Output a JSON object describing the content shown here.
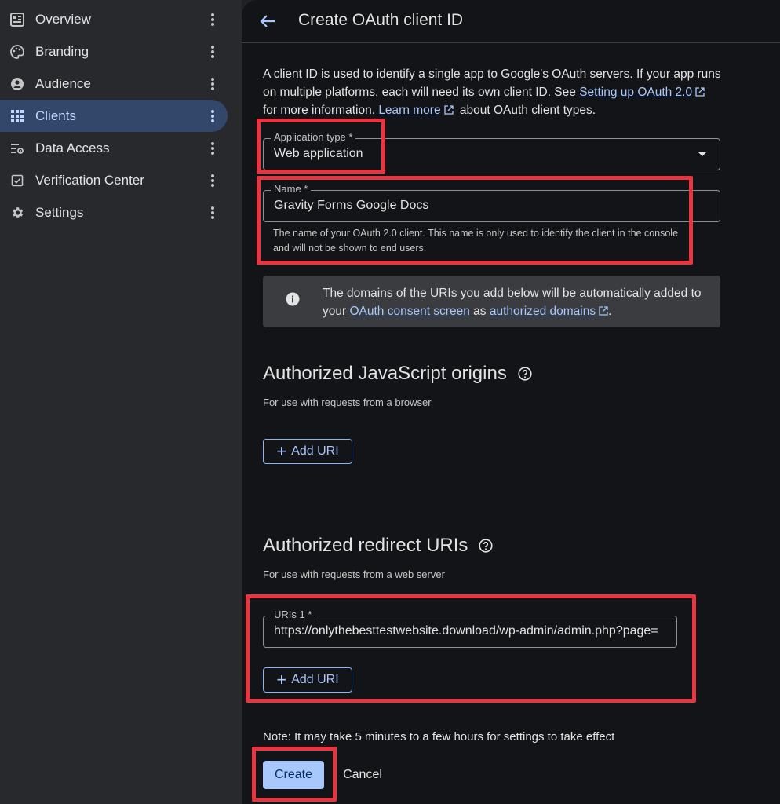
{
  "sidebar": {
    "items": [
      {
        "label": "Overview",
        "icon": "dashboard-icon"
      },
      {
        "label": "Branding",
        "icon": "palette-icon"
      },
      {
        "label": "Audience",
        "icon": "person-icon"
      },
      {
        "label": "Clients",
        "icon": "grid-icon",
        "active": true
      },
      {
        "label": "Data Access",
        "icon": "data-access-icon"
      },
      {
        "label": "Verification Center",
        "icon": "verification-icon"
      },
      {
        "label": "Settings",
        "icon": "gear-icon"
      }
    ]
  },
  "header": {
    "title": "Create OAuth client ID"
  },
  "intro": {
    "text1": "A client ID is used to identify a single app to Google's OAuth servers. If your app runs on multiple platforms, each will need its own client ID. See",
    "link1": "Setting up OAuth 2.0",
    "text2": "for more information.",
    "link2": "Learn more",
    "text3": "about OAuth client types."
  },
  "app_type": {
    "label": "Application type *",
    "value": "Web application"
  },
  "name_field": {
    "label": "Name *",
    "value": "Gravity Forms Google Docs",
    "hint": "The name of your OAuth 2.0 client. This name is only used to identify the client in the console and will not be shown to end users."
  },
  "info": {
    "text1": "The domains of the URIs you add below will be automatically added to your",
    "link1": "OAuth consent screen",
    "text2": "as",
    "link2": "authorized domains",
    "text3": "."
  },
  "js_origins": {
    "title": "Authorized JavaScript origins",
    "subtitle": "For use with requests from a browser",
    "add_label": "Add URI"
  },
  "redirect_uris": {
    "title": "Authorized redirect URIs",
    "subtitle": "For use with requests from a web server",
    "uri_label": "URIs 1 *",
    "uri_value": "https://onlythebesttestwebsite.download/wp-admin/admin.php?page=",
    "add_label": "Add URI"
  },
  "footer": {
    "note": "Note: It may take 5 minutes to a few hours for settings to take effect",
    "create_label": "Create",
    "cancel_label": "Cancel"
  },
  "colors": {
    "accent": "#a8c7fa",
    "highlight": "#e8353f",
    "active_nav": "#33476a"
  }
}
